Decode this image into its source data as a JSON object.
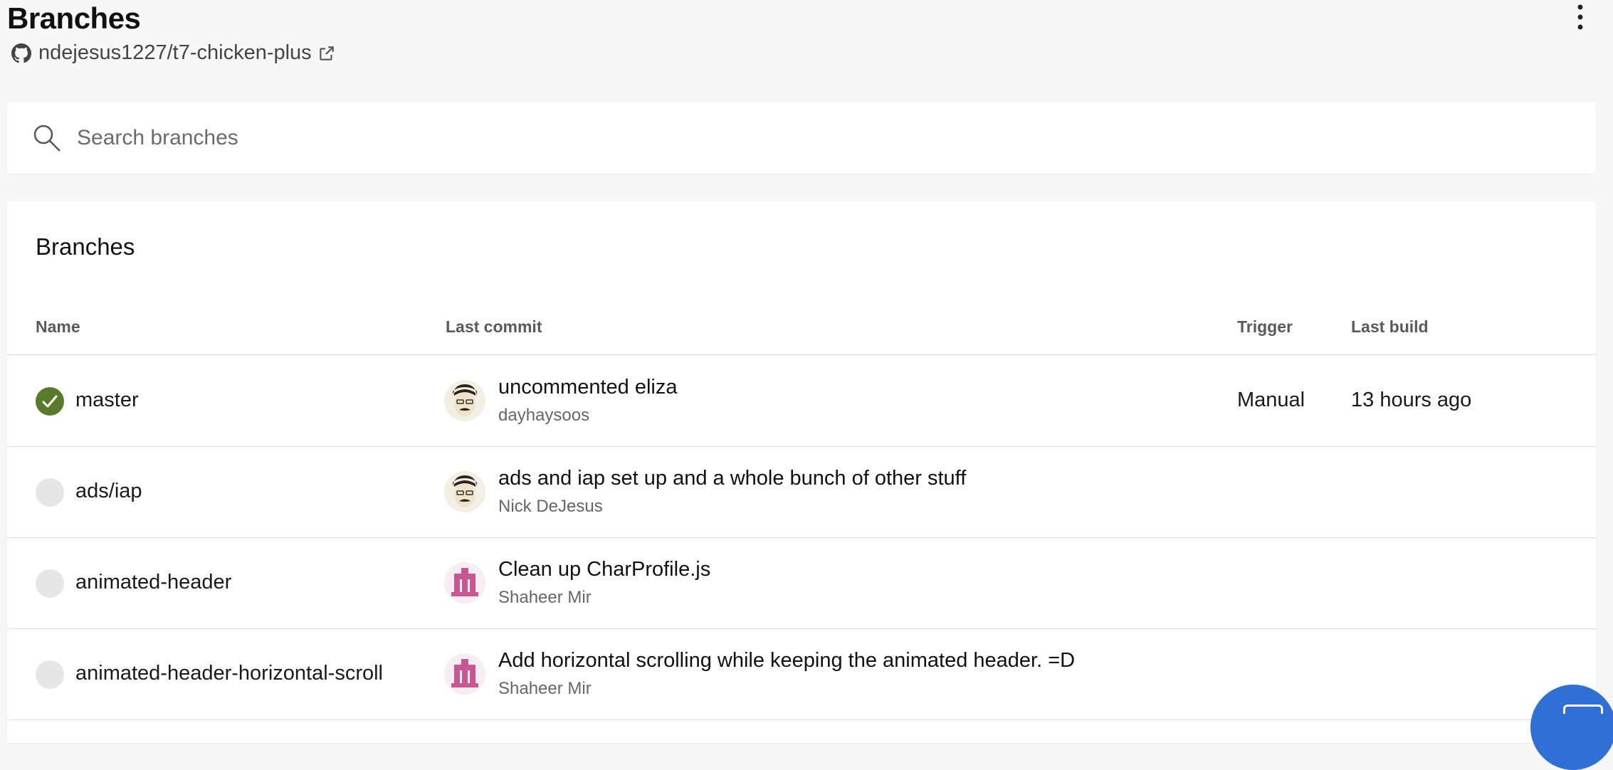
{
  "header": {
    "title": "Branches",
    "repo": "ndejesus1227/t7-chicken-plus"
  },
  "search": {
    "placeholder": "Search branches",
    "value": ""
  },
  "table": {
    "title": "Branches",
    "columns": {
      "name": "Name",
      "last_commit": "Last commit",
      "trigger": "Trigger",
      "last_build": "Last build"
    },
    "rows": [
      {
        "status": "success",
        "name": "master",
        "avatar": "mustache-face-avatar",
        "commit_message": "uncommented eliza",
        "commit_author": "dayhaysoos",
        "trigger": "Manual",
        "last_build": "13 hours ago"
      },
      {
        "status": "none",
        "name": "ads/iap",
        "avatar": "mustache-face-avatar",
        "commit_message": "ads and iap set up and a whole bunch of other stuff",
        "commit_author": "Nick DeJesus",
        "trigger": "",
        "last_build": ""
      },
      {
        "status": "none",
        "name": "animated-header",
        "avatar": "pink-identicon-avatar",
        "commit_message": "Clean up CharProfile.js",
        "commit_author": "Shaheer Mir",
        "trigger": "",
        "last_build": ""
      },
      {
        "status": "none",
        "name": "animated-header-horizontal-scroll",
        "avatar": "pink-identicon-avatar",
        "commit_message": "Add horizontal scrolling while keeping the animated header. =D",
        "commit_author": "Shaheer Mir",
        "trigger": "",
        "last_build": ""
      }
    ]
  },
  "colors": {
    "success": "#587a2b",
    "pending": "#e6e6e6",
    "fab": "#2f6fd6",
    "identicon": "#c8578f"
  }
}
